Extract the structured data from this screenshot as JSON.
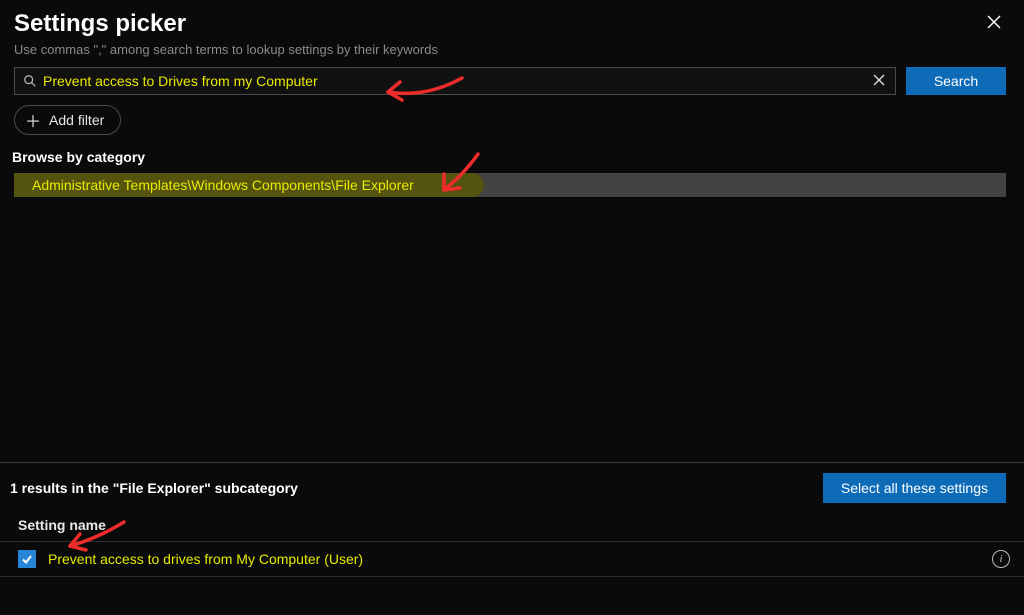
{
  "header": {
    "title": "Settings picker",
    "subtitle": "Use commas \",\" among search terms to lookup settings by their keywords"
  },
  "search": {
    "value": "Prevent access to Drives from my Computer",
    "button": "Search"
  },
  "filter": {
    "add_label": "Add filter"
  },
  "browse": {
    "heading": "Browse by category",
    "category_path": "Administrative Templates\\Windows Components\\File Explorer"
  },
  "results": {
    "summary": "1 results in the \"File Explorer\" subcategory",
    "select_all": "Select all these settings",
    "column_header": "Setting name",
    "items": [
      {
        "checked": true,
        "name": "Prevent access to drives from My Computer (User)"
      }
    ]
  }
}
